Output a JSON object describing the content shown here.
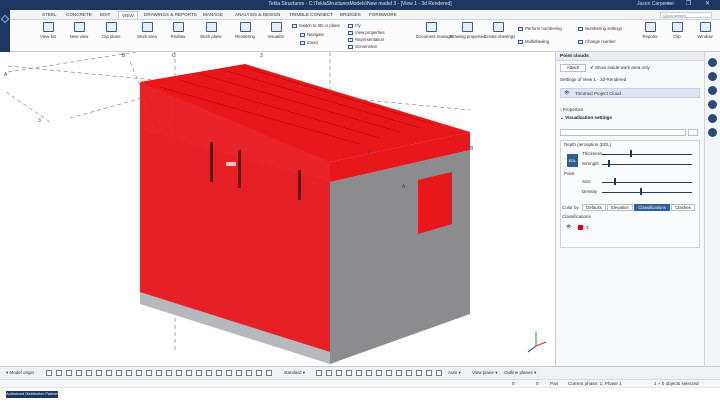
{
  "window": {
    "title": "Tekla Structures - C:\\TeklaStructuresModels\\New model 3 - [View 1 - 3d Rendered]",
    "user": "Jason Carpenter",
    "controls": "— ❐ ✕"
  },
  "tabs": {
    "items": [
      "STEEL",
      "CONCRETE",
      "EDIT",
      "VIEW",
      "DRAWINGS & REPORTS",
      "MANAGE",
      "ANALYSIS & DESIGN",
      "TRIMBLE CONNECT",
      "BRIDGES",
      "FORMWORK"
    ],
    "search_placeholder": "Quick search"
  },
  "ribbon": {
    "view_list": "View list",
    "new_view": "New view",
    "clip_plane": "Clip plane",
    "work_area": "Work area",
    "redraw": "Redraw",
    "work_plane": "Work plane",
    "rendering": "Rendering",
    "visualize": "Visualize",
    "switch": "Switch to 3D or plane",
    "navigate": "Navigate",
    "zoom": "Zoom",
    "fly": "Fly",
    "view_properties": "View properties",
    "representation": "Representation",
    "screenshot": "Screenshot",
    "document_manager": "Document manager",
    "drawing_properties": "Drawing properties",
    "create_drawings": "Create drawings",
    "perform_numbering": "Perform numbering",
    "multidrawing": "Multidrawing",
    "numbering_settings": "Numbering settings",
    "change_number": "Change number",
    "reports": "Reports",
    "clip": "Clip",
    "window": "Window"
  },
  "viewport": {
    "grid_labels": {
      "a_left": "A",
      "b_top": "B",
      "c_top": "C",
      "three_top": "3",
      "three_left": "3",
      "two_mid": "2",
      "b_right": "B",
      "a_face": "A"
    },
    "colors": {
      "cloud": "#e8171b",
      "wall_gray": "#8c8c8e",
      "wall_light": "#b7b8bc",
      "slab": "#c9cacd"
    }
  },
  "panel": {
    "title": "Point clouds",
    "attach": "Attach",
    "show_inside": "Show inside work area only",
    "settings_of": "Settings of View 1 - 3d-Rendered",
    "cloud_name": "Trimmed Project Cloud",
    "properties": "Properties",
    "visualization": "Visualization settings",
    "depth_perception": "Depth perception (EDL)",
    "edl": "EDL",
    "thickness": "Thickness",
    "strength": "Strength",
    "point": "Point",
    "size": "Size",
    "density": "Density",
    "color_by": "Color by",
    "color_defaults": "Defaults",
    "color_elevation": "Elevation",
    "color_classifications": "Classifications",
    "color_clashes": "Clashes",
    "classifications": "Classifications",
    "class_value": "3"
  },
  "bottombar": {
    "model_origin": "Model origin",
    "standard": "standard",
    "auto": "Auto",
    "view_plane": "View plane",
    "outline_planes": "Outline planes"
  },
  "status": {
    "zero1": "0",
    "zero2": "0",
    "pan": "Pan",
    "phase": "Current phase: 1, Phase 1",
    "objects": "1 + 0 objects selected"
  },
  "partner": "Authorized Distribution Partner"
}
